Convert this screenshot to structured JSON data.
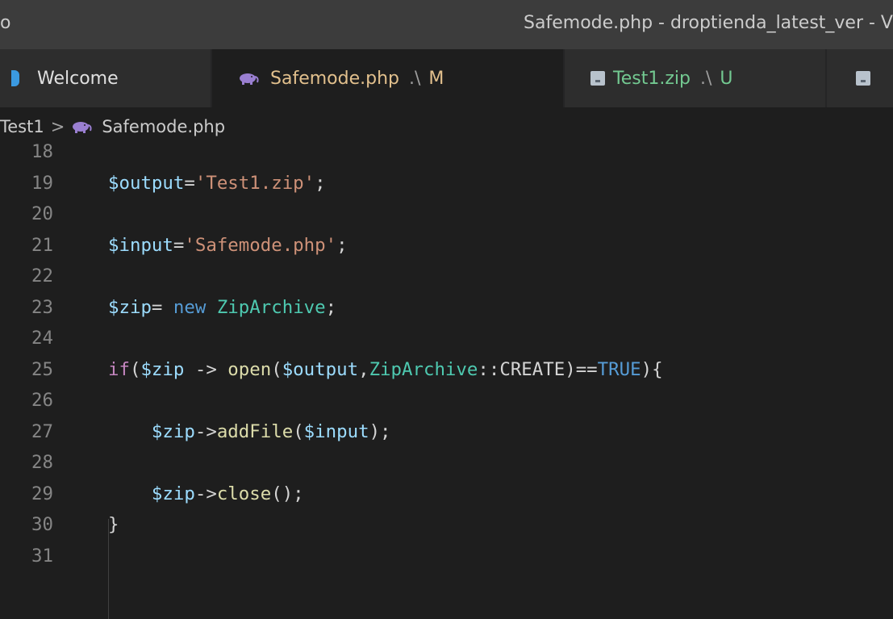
{
  "titlebar": {
    "app_glyph": "o",
    "title": "Safemode.php - droptienda_latest_ver - V"
  },
  "tabs": [
    {
      "icon": "vscode-icon",
      "label": "Welcome"
    },
    {
      "icon": "php-elephant-icon",
      "label": "Safemode.php",
      "path": ".\\",
      "status": "M",
      "active": true
    },
    {
      "icon": "zip-file-icon",
      "label": "Test1.zip",
      "path": ".\\",
      "status": "U"
    },
    {
      "icon": "zip-file-icon"
    }
  ],
  "breadcrumb": {
    "folder": "Test1",
    "separator": ">",
    "file": "Safemode.php"
  },
  "editor": {
    "lines": [
      {
        "number": "18",
        "tokens": []
      },
      {
        "number": "19",
        "tokens": [
          {
            "t": "var",
            "v": "$output"
          },
          {
            "t": "op",
            "v": "="
          },
          {
            "t": "str",
            "v": "'Test1.zip'"
          },
          {
            "t": "op",
            "v": ";"
          }
        ]
      },
      {
        "number": "20",
        "tokens": []
      },
      {
        "number": "21",
        "tokens": [
          {
            "t": "var",
            "v": "$input"
          },
          {
            "t": "op",
            "v": "="
          },
          {
            "t": "str",
            "v": "'Safemode.php'"
          },
          {
            "t": "op",
            "v": ";"
          }
        ]
      },
      {
        "number": "22",
        "tokens": []
      },
      {
        "number": "23",
        "tokens": [
          {
            "t": "var",
            "v": "$zip"
          },
          {
            "t": "op",
            "v": "= "
          },
          {
            "t": "kw",
            "v": "new"
          },
          {
            "t": "op",
            "v": " "
          },
          {
            "t": "cls",
            "v": "ZipArchive"
          },
          {
            "t": "op",
            "v": ";"
          }
        ]
      },
      {
        "number": "24",
        "tokens": []
      },
      {
        "number": "25",
        "tokens": [
          {
            "t": "kw2",
            "v": "if"
          },
          {
            "t": "op",
            "v": "("
          },
          {
            "t": "var",
            "v": "$zip"
          },
          {
            "t": "op",
            "v": " -> "
          },
          {
            "t": "fn",
            "v": "open"
          },
          {
            "t": "op",
            "v": "("
          },
          {
            "t": "var",
            "v": "$output"
          },
          {
            "t": "op",
            "v": ","
          },
          {
            "t": "cls",
            "v": "ZipArchive"
          },
          {
            "t": "op",
            "v": "::CREATE)=="
          },
          {
            "t": "kw",
            "v": "TRUE"
          },
          {
            "t": "op",
            "v": "){"
          }
        ]
      },
      {
        "number": "26",
        "tokens": []
      },
      {
        "number": "27",
        "tokens": [
          {
            "t": "op",
            "v": "    "
          },
          {
            "t": "var",
            "v": "$zip"
          },
          {
            "t": "op",
            "v": "->"
          },
          {
            "t": "fn",
            "v": "addFile"
          },
          {
            "t": "op",
            "v": "("
          },
          {
            "t": "var",
            "v": "$input"
          },
          {
            "t": "op",
            "v": ");"
          }
        ]
      },
      {
        "number": "28",
        "tokens": []
      },
      {
        "number": "29",
        "tokens": [
          {
            "t": "op",
            "v": "    "
          },
          {
            "t": "var",
            "v": "$zip"
          },
          {
            "t": "op",
            "v": "->"
          },
          {
            "t": "fn",
            "v": "close"
          },
          {
            "t": "op",
            "v": "();"
          }
        ]
      },
      {
        "number": "30",
        "tokens": [
          {
            "t": "op",
            "v": "}"
          }
        ]
      },
      {
        "number": "31",
        "tokens": []
      }
    ]
  }
}
